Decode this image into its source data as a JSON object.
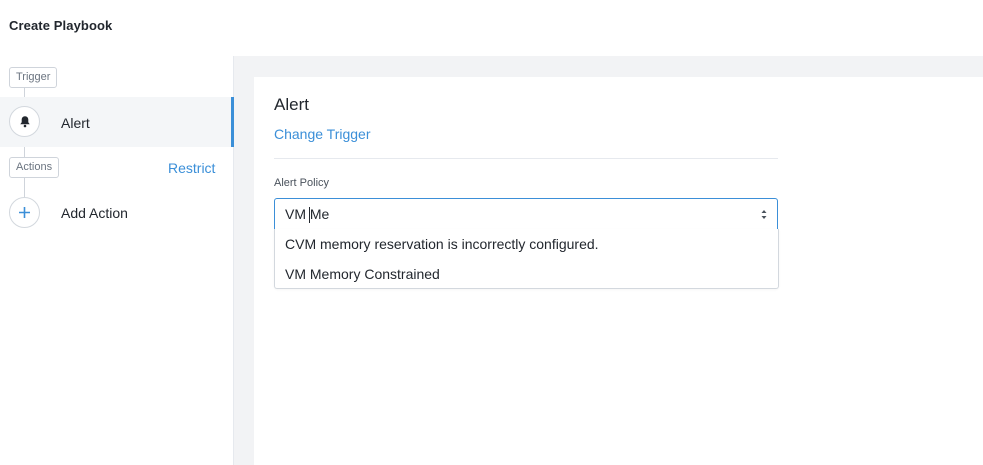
{
  "header": {
    "title": "Create Playbook"
  },
  "sidebar": {
    "trigger_tag": "Trigger",
    "trigger_item": {
      "label": "Alert",
      "icon": "bell-icon"
    },
    "actions_tag": "Actions",
    "restrict_label": "Restrict",
    "add_action": {
      "label": "Add Action",
      "icon": "plus-icon"
    }
  },
  "main": {
    "section_title": "Alert",
    "change_trigger_label": "Change Trigger",
    "alert_policy": {
      "label": "Alert Policy",
      "value": "VM Me",
      "options": [
        "CVM memory reservation is incorrectly configured.",
        "VM Memory Constrained"
      ]
    }
  },
  "colors": {
    "accent": "#3b8fd8",
    "content_background": "#f2f3f5",
    "text": "#22272e"
  }
}
